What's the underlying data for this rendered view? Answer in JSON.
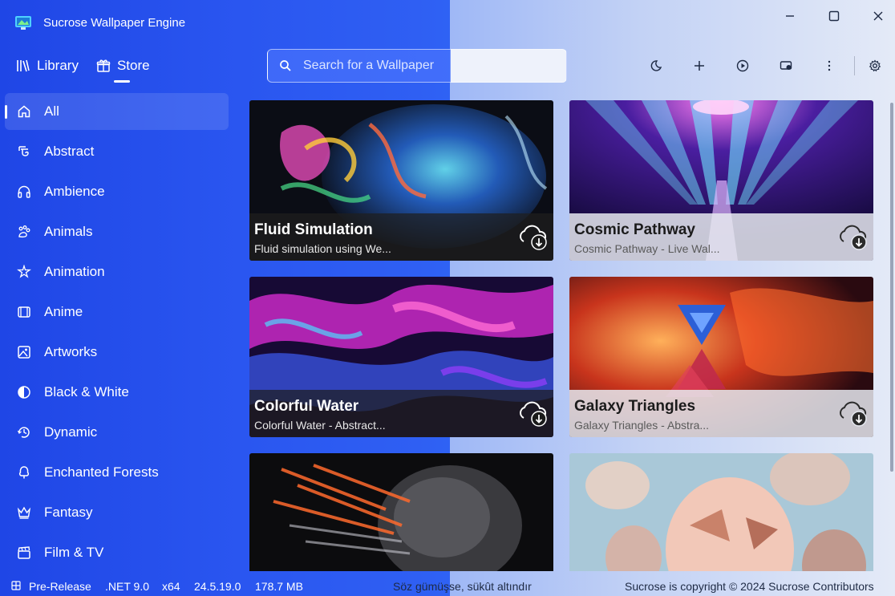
{
  "app": {
    "title": "Sucrose Wallpaper Engine"
  },
  "window_controls": {
    "minimize": "—",
    "maximize": "☐",
    "close": "✕"
  },
  "nav": {
    "library_label": "Library",
    "store_label": "Store",
    "active": "Store"
  },
  "search": {
    "placeholder": "Search for a Wallpaper"
  },
  "toolbar": {
    "items": [
      "theme-moon-icon",
      "add-icon",
      "play-icon",
      "display-icon",
      "more-icon",
      "settings-gear-icon"
    ]
  },
  "sidebar": {
    "items": [
      {
        "label": "All",
        "icon": "home-icon",
        "active": true
      },
      {
        "label": "Abstract",
        "icon": "abstract-icon"
      },
      {
        "label": "Ambience",
        "icon": "headphones-icon"
      },
      {
        "label": "Animals",
        "icon": "paw-icon"
      },
      {
        "label": "Animation",
        "icon": "sparkle-icon"
      },
      {
        "label": "Anime",
        "icon": "film-frame-icon"
      },
      {
        "label": "Artworks",
        "icon": "image-icon"
      },
      {
        "label": "Black & White",
        "icon": "contrast-icon"
      },
      {
        "label": "Dynamic",
        "icon": "clock-refresh-icon"
      },
      {
        "label": "Enchanted Forests",
        "icon": "tree-icon"
      },
      {
        "label": "Fantasy",
        "icon": "crown-icon"
      },
      {
        "label": "Film & TV",
        "icon": "clapper-icon"
      }
    ]
  },
  "wallpapers": [
    {
      "title": "Fluid Simulation",
      "subtitle": "Fluid simulation using We...",
      "theme": "dark"
    },
    {
      "title": "Cosmic Pathway",
      "subtitle": "Cosmic Pathway - Live Wal...",
      "theme": "light"
    },
    {
      "title": "Colorful Water",
      "subtitle": "Colorful Water - Abstract...",
      "theme": "dark"
    },
    {
      "title": "Galaxy Triangles",
      "subtitle": "Galaxy Triangles - Abstra...",
      "theme": "light"
    },
    {
      "title": "",
      "subtitle": "",
      "theme": "dark"
    },
    {
      "title": "",
      "subtitle": "",
      "theme": "light"
    }
  ],
  "statusbar": {
    "channel": "Pre-Release",
    "framework": ".NET 9.0",
    "arch": "x64",
    "version": "24.5.19.0",
    "memory": "178.7 MB",
    "quote": "Söz gümüşse, sükût altındır",
    "copyright": "Sucrose is copyright © 2024 Sucrose Contributors"
  },
  "colors": {
    "sidebar_gradient_start": "#1f46e6",
    "content_light": "#e4eaf7",
    "accent": "#2f62f4"
  }
}
